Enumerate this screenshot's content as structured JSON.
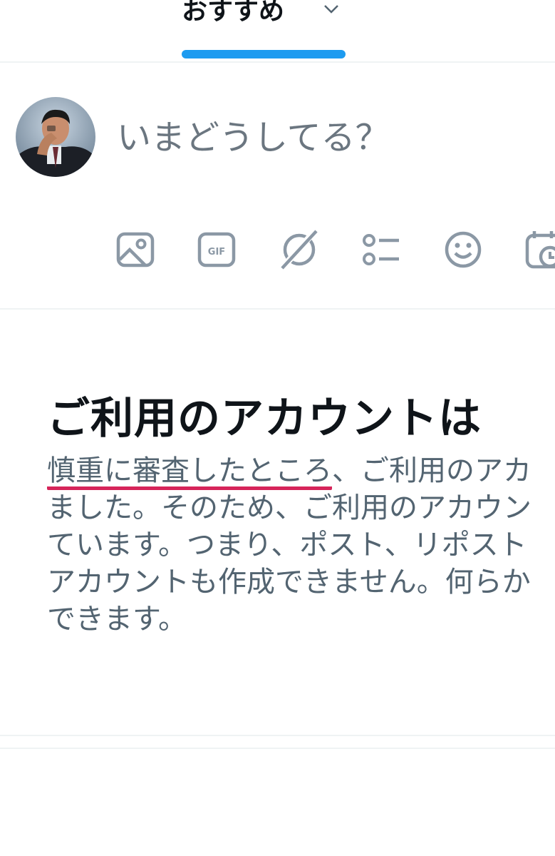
{
  "header": {
    "tab_label": "おすすめ",
    "tab_icon": "chevron-down-icon",
    "accent_color": "#1d9bf0"
  },
  "composer": {
    "placeholder": "いまどうしてる？",
    "toolbar": [
      {
        "name": "media-icon"
      },
      {
        "name": "gif-icon",
        "label": "GIF"
      },
      {
        "name": "grok-icon"
      },
      {
        "name": "poll-icon"
      },
      {
        "name": "emoji-icon"
      },
      {
        "name": "schedule-icon"
      }
    ],
    "icon_color": "#8b98a5"
  },
  "notice": {
    "title": "ご利用のアカウントは",
    "body_lines": [
      {
        "highlight": "慎重に審査したところ",
        "rest": "、ご利用のアカ"
      },
      {
        "text": "ました。そのため、ご利用のアカウン"
      },
      {
        "text": "ています。つまり、ポスト、リポスト"
      },
      {
        "text": "アカウントも作成できません。何らか"
      },
      {
        "text": "できます。"
      }
    ],
    "highlight_color": "#d6245a"
  }
}
